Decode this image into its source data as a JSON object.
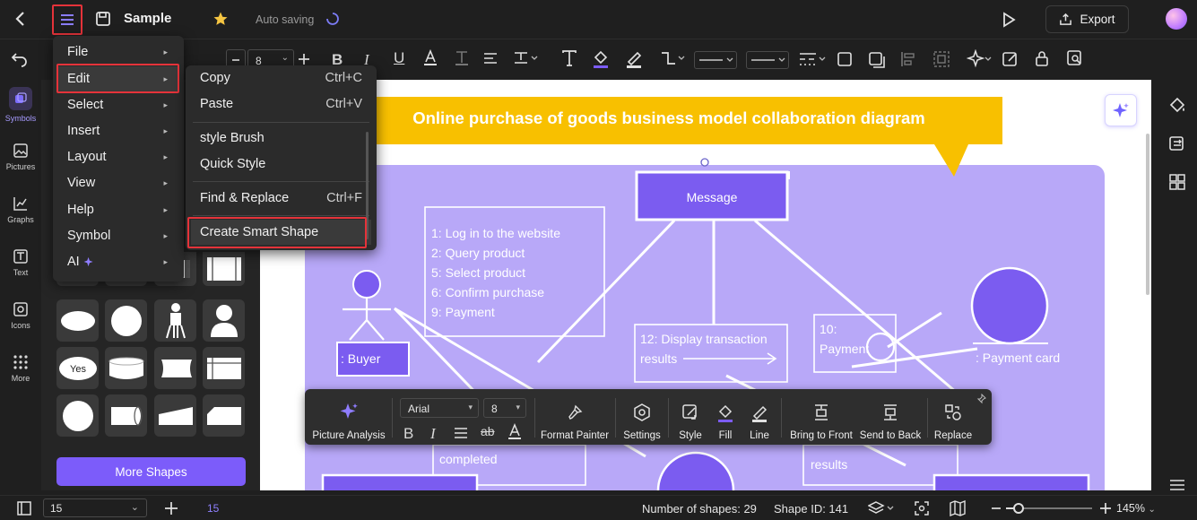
{
  "topbar": {
    "doc_title": "Sample",
    "autosave": "Auto saving",
    "export_label": "Export"
  },
  "toolbar": {
    "font_size": "8"
  },
  "left_rail": {
    "items": [
      {
        "label": "Symbols",
        "icon": "symbols-icon"
      },
      {
        "label": "Pictures",
        "icon": "pictures-icon"
      },
      {
        "label": "Graphs",
        "icon": "graphs-icon"
      },
      {
        "label": "Text",
        "icon": "text-icon"
      },
      {
        "label": "Icons",
        "icon": "icons-icon"
      },
      {
        "label": "More",
        "icon": "more-icon"
      }
    ]
  },
  "shape_panel": {
    "more_shapes_label": "More Shapes",
    "yes_label": "Yes"
  },
  "main_menu": {
    "items": [
      {
        "label": "File"
      },
      {
        "label": "Edit"
      },
      {
        "label": "Select"
      },
      {
        "label": "Insert"
      },
      {
        "label": "Layout"
      },
      {
        "label": "View"
      },
      {
        "label": "Help"
      },
      {
        "label": "Symbol"
      },
      {
        "label": "AI"
      }
    ]
  },
  "edit_submenu": {
    "copy": "Copy",
    "copy_sc": "Ctrl+C",
    "paste": "Paste",
    "paste_sc": "Ctrl+V",
    "style_brush": "style Brush",
    "quick_style": "Quick Style",
    "find_replace": "Find & Replace",
    "find_replace_sc": "Ctrl+F",
    "create_smart_shape": "Create Smart Shape"
  },
  "diagram": {
    "title": "Online purchase of goods business model collaboration diagram",
    "message": "Message",
    "steps": [
      "1: Log in to the website",
      "2: Query product",
      "5: Select product",
      "6: Confirm purchase",
      "9: Payment"
    ],
    "buyer": ": Buyer",
    "display_transaction_1": "12: Display transaction",
    "display_transaction_2": "results",
    "payment_1": "10:",
    "payment_2": "Payment",
    "payment_card": ": Payment card",
    "completed": "completed",
    "results": "results"
  },
  "floatbar": {
    "picture_analysis": "Picture Analysis",
    "font": "Arial",
    "size": "8",
    "format_painter": "Format Painter",
    "settings": "Settings",
    "style": "Style",
    "fill": "Fill",
    "line": "Line",
    "bring_front": "Bring to Front",
    "send_back": "Send to Back",
    "replace": "Replace",
    "ab": "ab"
  },
  "statusbar": {
    "page_select": "15",
    "page_num": "15",
    "shape_count": "Number of shapes: 29",
    "shape_id": "Shape ID: 141",
    "zoom": "145%"
  },
  "colors": {
    "accent": "#7c5cfa",
    "highlight": "#e5333a",
    "diagram_bg": "#b8a8f8",
    "title_band": "#f8c000",
    "shape_fill": "#7b5cf0"
  }
}
